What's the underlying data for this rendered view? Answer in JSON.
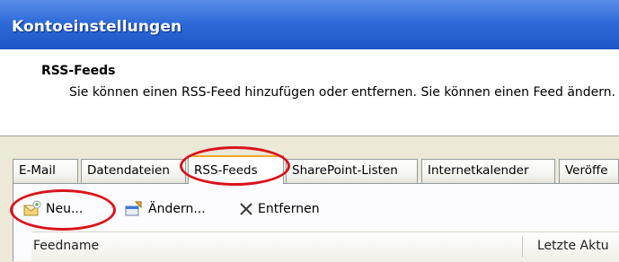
{
  "window": {
    "title": "Kontoeinstellungen"
  },
  "header": {
    "title": "RSS-Feeds",
    "description": "Sie können einen RSS-Feed hinzufügen oder entfernen. Sie können einen Feed ändern."
  },
  "tabs": [
    {
      "label": "E-Mail"
    },
    {
      "label": "Datendateien"
    },
    {
      "label": "RSS-Feeds",
      "active": true
    },
    {
      "label": "SharePoint-Listen"
    },
    {
      "label": "Internetkalender"
    },
    {
      "label": "Veröffe"
    }
  ],
  "toolbar": {
    "new_label": "Neu...",
    "change_label": "Ändern...",
    "remove_label": "Entfernen"
  },
  "list": {
    "columns": [
      "Feedname",
      "Letzte Aktu"
    ]
  },
  "colors": {
    "titlebar": "#2f6bd9",
    "highlight": "#d9141b",
    "active_tab_accent": "#f5a623"
  }
}
